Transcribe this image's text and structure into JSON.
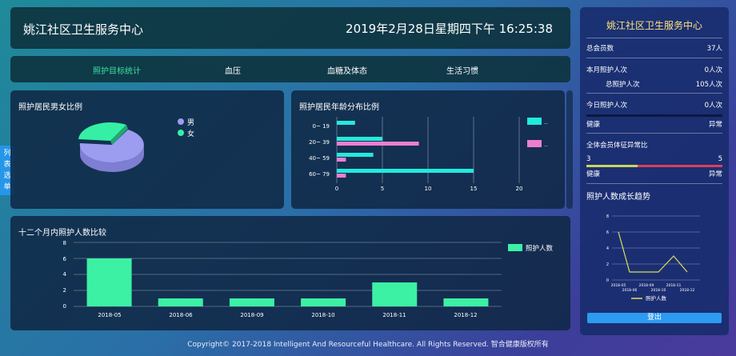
{
  "header": {
    "title": "姚江社区卫生服务中心",
    "datetime": "2019年2月28日星期四下午 16:25:38"
  },
  "tabs": [
    {
      "label": "照护目标统计",
      "active": true
    },
    {
      "label": "血压",
      "active": false
    },
    {
      "label": "血糖及体态",
      "active": false
    },
    {
      "label": "生活习惯",
      "active": false
    }
  ],
  "side_menu": {
    "chars": [
      "列",
      "表",
      "选",
      "单"
    ]
  },
  "gender_panel": {
    "title": "照护居民男女比例"
  },
  "age_panel": {
    "title": "照护居民年龄分布比例",
    "legend_dots": [
      "..",
      ".."
    ]
  },
  "monthly_panel": {
    "title": "十二个月内照护人数比较"
  },
  "right": {
    "title": "姚江社区卫生服务中心",
    "total_label": "总会员数",
    "total_value": "37人",
    "month_label": "本月照护人次",
    "month_value": "0人次",
    "all_label": "总照护人次",
    "all_value": "105人次",
    "today_label": "今日照护人次",
    "today_value": "0人次",
    "healthy_label": "健康",
    "abnormal_label": "异常",
    "ratio_title": "全体会员体征异常比",
    "ratio_left": "3",
    "ratio_right": "5",
    "healthy2_label": "健康",
    "abnormal2_label": "异常",
    "trend_title": "照护人数成长趋势",
    "logout_label": "登出"
  },
  "footer": {
    "text": "Copyright© 2017-2018 Intelligent And Resourceful Healthcare. All Rights Reserved. 智合健康版权所有"
  },
  "colors": {
    "male": "#9c9cf0",
    "female": "#35f0a4",
    "cyan": "#22eadc",
    "pink": "#ec7ed0",
    "bar": "#3cf0a4",
    "line": "#d8e05a",
    "accent": "#39e0a0"
  },
  "chart_data": [
    {
      "type": "pie",
      "legend": [
        "男",
        "女"
      ],
      "labels": [
        "男",
        "女"
      ],
      "values": [
        75,
        25
      ]
    },
    {
      "type": "bar",
      "orientation": "horizontal",
      "categories": [
        "0~ 19",
        "20~ 39",
        "40~ 59",
        "60~ 79"
      ],
      "series": [
        {
          "values": [
            2,
            5,
            4,
            15
          ]
        },
        {
          "values": [
            0,
            9,
            1,
            1
          ]
        }
      ],
      "xticks": [
        "0",
        "5",
        "10",
        "15",
        "20"
      ],
      "xlim": [
        0,
        20
      ]
    },
    {
      "type": "bar",
      "categories": [
        "2018-05",
        "2018-06",
        "2018-09",
        "2018-10",
        "2018-11",
        "2018-12"
      ],
      "series": [
        {
          "name": "照护人数",
          "values": [
            6,
            1,
            1,
            1,
            3,
            1
          ]
        }
      ],
      "yticks": [
        "0",
        "2",
        "4",
        "6",
        "8"
      ],
      "ylim": [
        0,
        8
      ],
      "legend": [
        "照护人数"
      ]
    },
    {
      "type": "line",
      "categories": [
        "2018-05",
        "2018-06",
        "2018-09",
        "2018-10",
        "2018-11",
        "2018-12"
      ],
      "series": [
        {
          "name": "照护人数",
          "values": [
            6,
            1,
            1,
            1,
            3,
            1
          ]
        }
      ],
      "yticks": [
        "0",
        "2",
        "4",
        "6",
        "8"
      ],
      "ylim": [
        0,
        8
      ],
      "legend": [
        "照护人数"
      ]
    }
  ]
}
